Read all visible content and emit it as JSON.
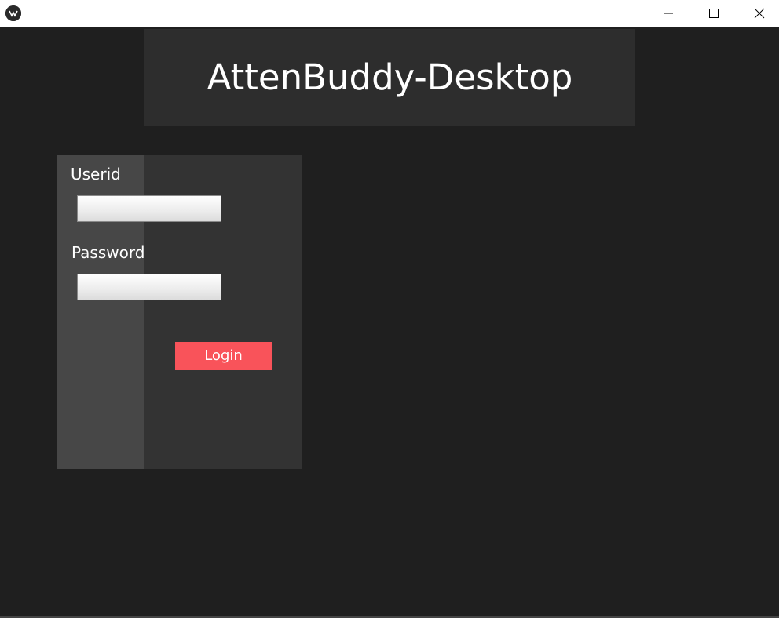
{
  "window": {
    "icon": "kivy-app-icon",
    "controls": {
      "minimize_icon": "minimize-icon",
      "maximize_icon": "maximize-icon",
      "close_icon": "close-icon"
    }
  },
  "header": {
    "title": "AttenBuddy-Desktop"
  },
  "login_form": {
    "userid_label": "Userid",
    "userid_value": "",
    "password_label": "Password",
    "password_value": "",
    "login_button_label": "Login"
  },
  "colors": {
    "background": "#1f1f1f",
    "header_panel": "#2d2d2d",
    "form_panel": "#333333",
    "form_panel_strip": "#474747",
    "login_button": "#f9535a",
    "text": "#ffffff"
  }
}
